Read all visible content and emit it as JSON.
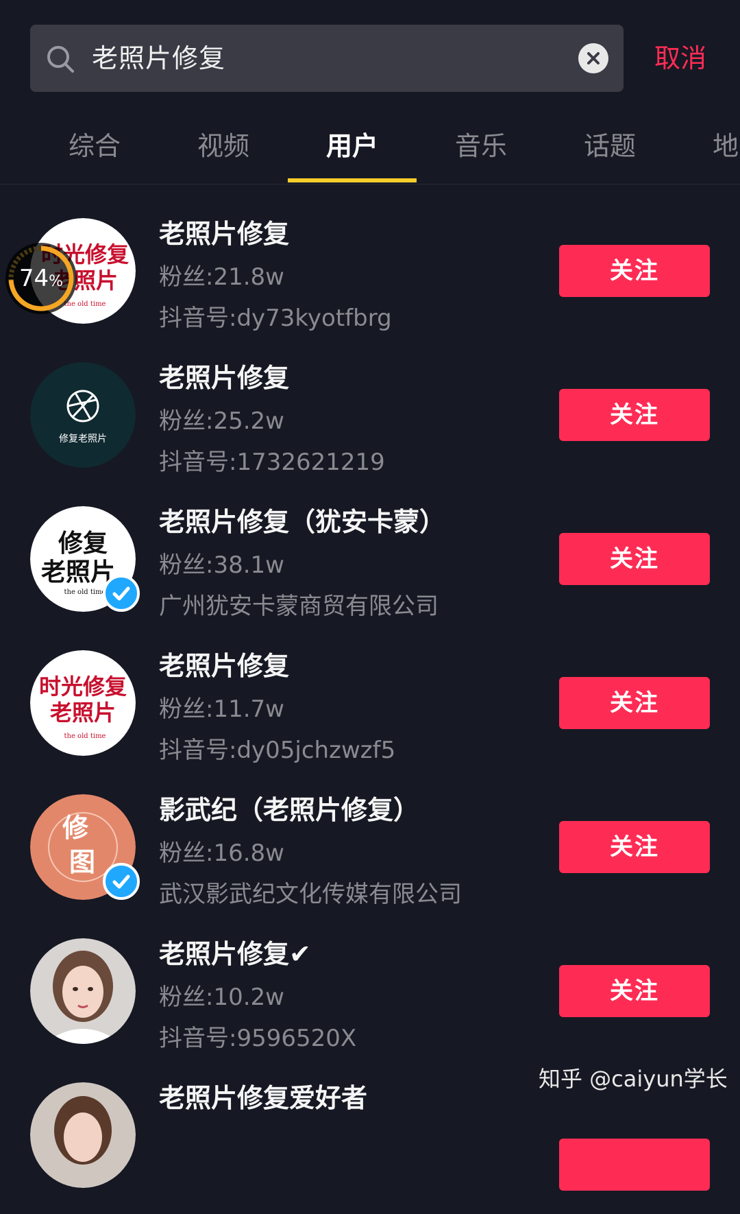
{
  "search": {
    "value": "老照片修复",
    "cancel_label": "取消"
  },
  "tabs": [
    {
      "label": "综合"
    },
    {
      "label": "视频"
    },
    {
      "label": "用户"
    },
    {
      "label": "音乐"
    },
    {
      "label": "话题"
    },
    {
      "label": "地"
    }
  ],
  "active_tab": "用户",
  "upload_progress": {
    "value": "74",
    "unit": "%"
  },
  "users": [
    {
      "name": "老照片修复",
      "fans": "粉丝:21.8w",
      "sub": "抖音号:dy73kyotfbrg",
      "follow_label": "关注",
      "verified": false,
      "avatar_text": [
        "时光修复",
        "老照片"
      ],
      "avatar_caption": "the old time"
    },
    {
      "name": "老照片修复",
      "fans": "粉丝:25.2w",
      "sub": "抖音号:1732621219",
      "follow_label": "关注",
      "verified": false,
      "avatar_text": [
        "修复老照片"
      ]
    },
    {
      "name": "老照片修复（犹安卡蒙）",
      "fans": "粉丝:38.1w",
      "sub": "广州犹安卡蒙商贸有限公司",
      "follow_label": "关注",
      "verified": true,
      "avatar_text": [
        "修复",
        "老照片"
      ],
      "avatar_caption": "the old time"
    },
    {
      "name": "老照片修复",
      "fans": "粉丝:11.7w",
      "sub": "抖音号:dy05jchzwzf5",
      "follow_label": "关注",
      "verified": false,
      "avatar_text": [
        "时光修复",
        "老照片"
      ],
      "avatar_caption": "the old time"
    },
    {
      "name": "影武纪（老照片修复）",
      "fans": "粉丝:16.8w",
      "sub": "武汉影武纪文化传媒有限公司",
      "follow_label": "关注",
      "verified": true,
      "avatar_text": [
        "修",
        "图"
      ]
    },
    {
      "name": "老照片修复✔",
      "fans": "粉丝:10.2w",
      "sub": "抖音号:9596520X",
      "follow_label": "关注",
      "verified": false
    },
    {
      "name": "老照片修复爱好者",
      "fans": "",
      "sub": "",
      "follow_label": "",
      "verified": false
    }
  ],
  "watermark": "知乎 @caiyun学长",
  "colors": {
    "background": "#161823",
    "accent": "#fe2c55",
    "tab_indicator": "#facd2b",
    "muted_text": "#8a8b91",
    "verified_blue": "#20a8ff"
  }
}
